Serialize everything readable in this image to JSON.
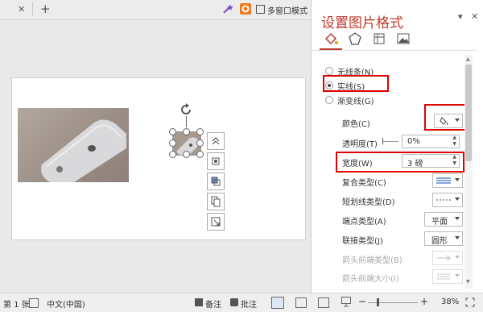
{
  "tabbar": {
    "close_glyph": "✕",
    "new_glyph": "+",
    "multi_window_label": "多窗口模式"
  },
  "panel": {
    "title": "设置图片格式",
    "options_glyph": "▾",
    "close_glyph": "✕",
    "tabs": [
      {
        "icon": "fill-bucket-icon"
      },
      {
        "icon": "pentagon-icon"
      },
      {
        "icon": "layout-size-icon"
      },
      {
        "icon": "picture-icon"
      }
    ],
    "line_options": [
      {
        "label": "无线条(N)",
        "selected": false
      },
      {
        "label": "实线(S)",
        "selected": true
      },
      {
        "label": "渐变线(G)",
        "selected": false
      }
    ],
    "color_label": "颜色(C)",
    "transparency_label": "透明度(T)",
    "transparency_value": "0%",
    "width_label": "宽度(W)",
    "width_value": "3 磅",
    "compound_label": "复合类型(C)",
    "dash_label": "短划线类型(D)",
    "cap_label": "端点类型(A)",
    "cap_value": "平面",
    "join_label": "联接类型(J)",
    "join_value": "圆形",
    "arrow_begin_type_label": "箭头前端类型(B)",
    "arrow_begin_size_label": "箭头前端大小(I)",
    "highlight_color": "#e00000",
    "title_color": "#c0392b"
  },
  "status": {
    "slide_count": "第 1 张",
    "language": "中文(中国)",
    "notes_label": "备注",
    "comments_label": "批注",
    "zoom_minus": "−",
    "zoom_plus": "+",
    "zoom_level": "38%"
  }
}
